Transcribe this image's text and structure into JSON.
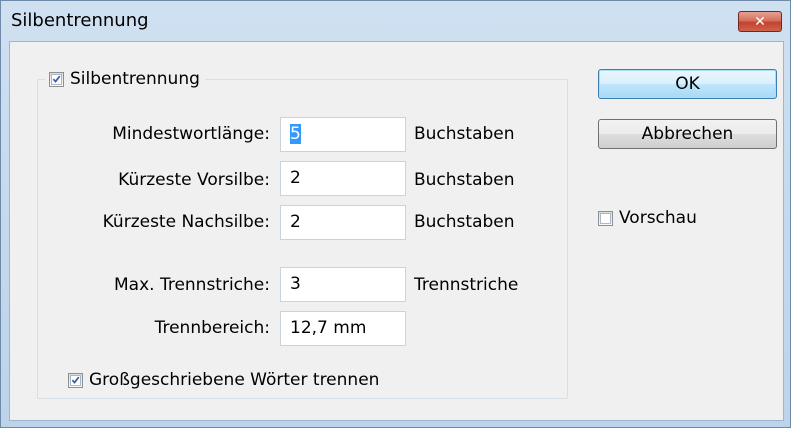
{
  "window": {
    "title": "Silbentrennung",
    "close_label": "✕"
  },
  "group": {
    "label": "Silbentrennung",
    "checked": true
  },
  "fields": [
    {
      "label": "Mindestwortlänge:",
      "value": "5",
      "unit": "Buchstaben"
    },
    {
      "label": "Kürzeste Vorsilbe:",
      "value": "2",
      "unit": "Buchstaben"
    },
    {
      "label": "Kürzeste Nachsilbe:",
      "value": "2",
      "unit": "Buchstaben"
    },
    {
      "label": "Max. Trennstriche:",
      "value": "3",
      "unit": "Trennstriche"
    },
    {
      "label": "Trennbereich:",
      "value": "12,7 mm",
      "unit": ""
    }
  ],
  "capitalized": {
    "label": "Großgeschriebene Wörter trennen",
    "checked": true
  },
  "buttons": {
    "ok": "OK",
    "cancel": "Abbrechen"
  },
  "preview": {
    "label": "Vorschau",
    "checked": false
  },
  "colors": {
    "selection": "#3399ff",
    "close": "#c2432f"
  }
}
